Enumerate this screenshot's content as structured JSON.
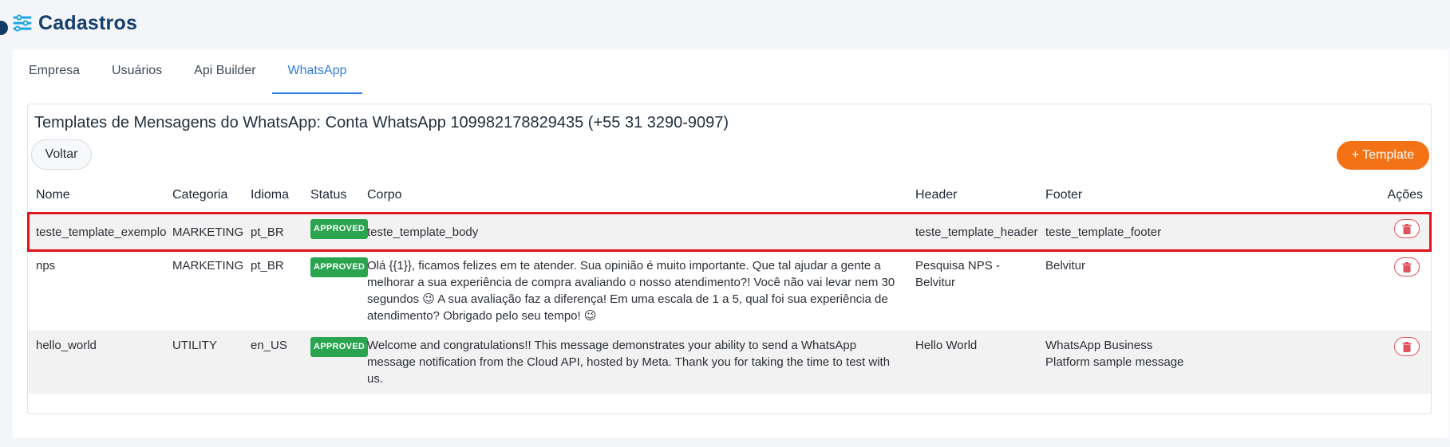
{
  "header": {
    "title": "Cadastros",
    "icon": "sliders-icon"
  },
  "tabs": [
    {
      "label": "Empresa",
      "active": false
    },
    {
      "label": "Usuários",
      "active": false
    },
    {
      "label": "Api Builder",
      "active": false
    },
    {
      "label": "WhatsApp",
      "active": true
    }
  ],
  "card": {
    "title": "Templates de Mensagens do WhatsApp: Conta WhatsApp 109982178829435 (+55 31 3290-9097)",
    "back_label": "Voltar",
    "add_label": "+ Template"
  },
  "table": {
    "columns": [
      "Nome",
      "Categoria",
      "Idioma",
      "Status",
      "Corpo",
      "Header",
      "Footer",
      "Ações"
    ],
    "rows": [
      {
        "nome": "teste_template_exemplo",
        "categoria": "MARKETING",
        "idioma": "pt_BR",
        "status": "APPROVED",
        "corpo": "teste_template_body",
        "header": "teste_template_header",
        "footer": "teste_template_footer"
      },
      {
        "nome": "nps",
        "categoria": "MARKETING",
        "idioma": "pt_BR",
        "status": "APPROVED",
        "corpo": "Olá {{1}}, ficamos felizes em te atender. Sua opinião é muito importante. Que tal ajudar a gente a melhorar a sua experiência de compra avaliando o nosso atendimento?! Você não vai levar nem 30 segundos 😉 A sua avaliação faz a diferença! Em uma escala de 1 a 5, qual foi sua experiência de atendimento? Obrigado pelo seu tempo! 😉",
        "header": "Pesquisa NPS - Belvitur",
        "footer": "Belvitur"
      },
      {
        "nome": "hello_world",
        "categoria": "UTILITY",
        "idioma": "en_US",
        "status": "APPROVED",
        "corpo": "Welcome and congratulations!! This message demonstrates your ability to send a WhatsApp message notification from the Cloud API, hosted by Meta. Thank you for taking the time to test with us.",
        "header": "Hello World",
        "footer": "WhatsApp Business Platform sample message"
      }
    ]
  },
  "colors": {
    "accent": "#2f7de1",
    "brand_dark": "#163f6e",
    "primary_button": "#f47216",
    "approved": "#2aa44f",
    "delete": "#e0535e",
    "highlight": "#e0131b"
  }
}
